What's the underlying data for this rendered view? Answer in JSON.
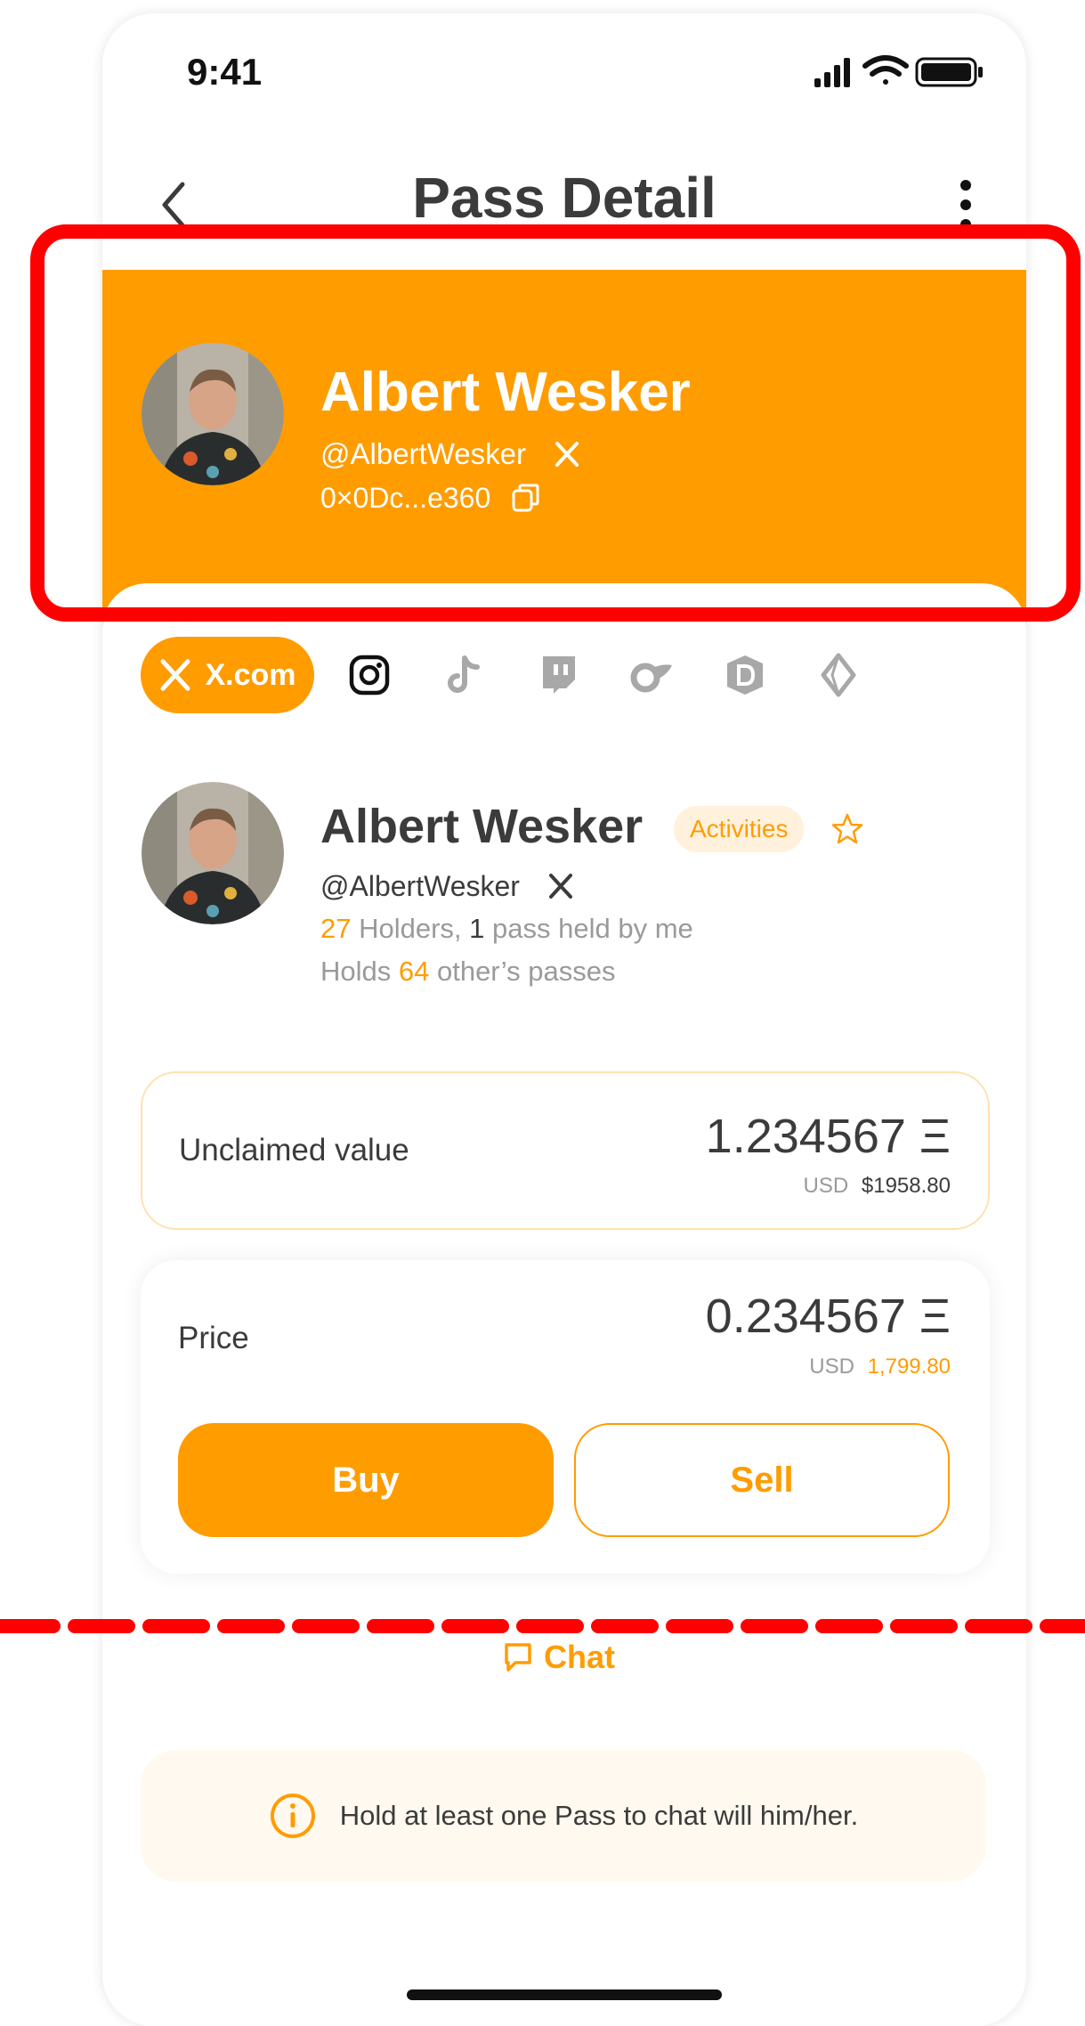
{
  "status_bar": {
    "time": "9:41"
  },
  "nav": {
    "title": "Pass Detail"
  },
  "header": {
    "name": "Albert Wesker",
    "handle": "@AlbertWesker",
    "address": "0×0Dc...e360"
  },
  "platforms": {
    "active_label": "X.com",
    "icons": [
      "x-icon",
      "instagram-icon",
      "tiktok-icon",
      "twitch-icon",
      "onlyfans-icon",
      "d-badge-icon",
      "diamond-icon"
    ]
  },
  "profile": {
    "name": "Albert Wesker",
    "badge": "Activities",
    "handle": "@AlbertWesker",
    "holders_count": "27",
    "holders_text": " Holders, ",
    "held_count": "1",
    "held_text": " pass held by me",
    "holds_prefix": "Holds ",
    "holds_count": "64",
    "holds_suffix": " other’s passes"
  },
  "unclaimed": {
    "label": "Unclaimed value",
    "value": "1.234567 Ξ",
    "usd_label": "USD",
    "usd_value": "$1958.80"
  },
  "price": {
    "label": "Price",
    "value": "0.234567 Ξ",
    "usd_label": "USD",
    "usd_value": "1,799.80"
  },
  "actions": {
    "buy": "Buy",
    "sell": "Sell"
  },
  "chat": {
    "label": "Chat"
  },
  "info": {
    "text": "Hold at least one Pass to chat will him/her."
  },
  "colors": {
    "accent": "#ff9c00",
    "annotation": "#ff0000"
  }
}
